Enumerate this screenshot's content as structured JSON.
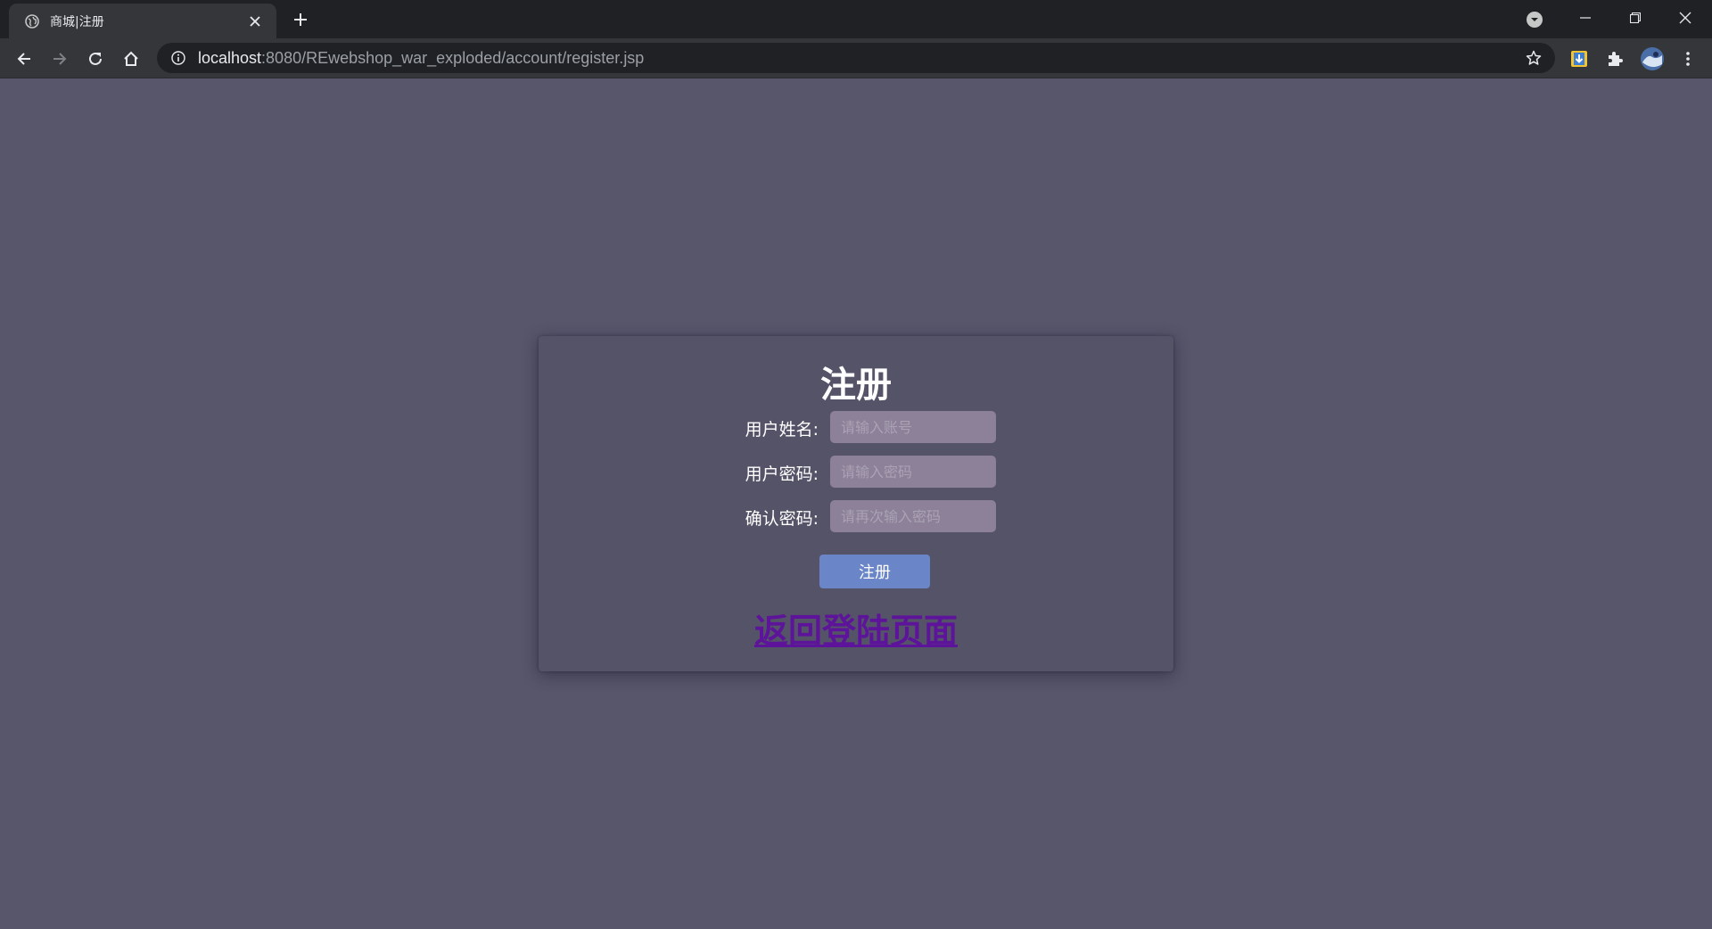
{
  "browser": {
    "tab": {
      "title": "商城|注册",
      "favicon": "globe-icon"
    },
    "address": {
      "host": "localhost",
      "rest": ":8080/REwebshop_war_exploded/account/register.jsp"
    },
    "icons": {
      "back": "arrow-left-icon",
      "forward": "arrow-right-icon",
      "reload": "reload-icon",
      "home": "home-icon",
      "info": "info-icon",
      "star": "star-icon",
      "extension_1": "download-extension-icon",
      "extension_2": "puzzle-icon",
      "profile": "avatar",
      "menu": "kebab-menu-icon"
    }
  },
  "form": {
    "title": "注册",
    "username": {
      "label": "用户姓名:",
      "placeholder": "请输入账号"
    },
    "password": {
      "label": "用户密码:",
      "placeholder": "请输入密码"
    },
    "confirm": {
      "label": "确认密码:",
      "placeholder": "请再次输入密码"
    },
    "submit_label": "注册",
    "back_link": "返回登陆页面"
  },
  "colors": {
    "page_bg": "#58566b",
    "card_bg": "#555368",
    "input_bg": "#8c8199",
    "button_bg": "#6a85c8",
    "link": "#5d139a"
  }
}
